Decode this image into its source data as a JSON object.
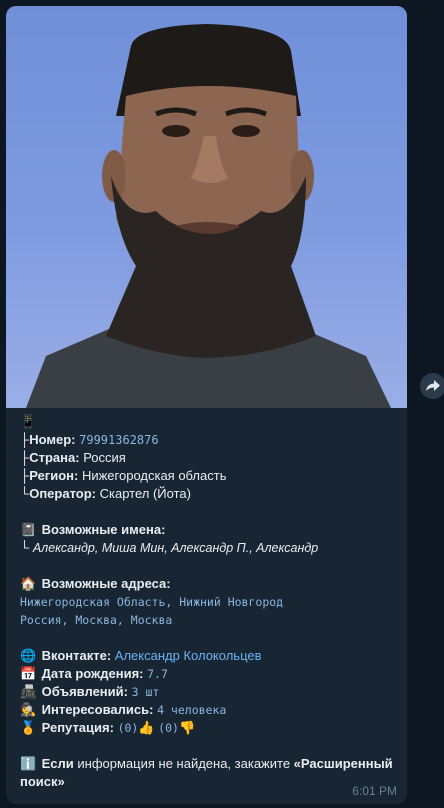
{
  "message": {
    "phone_emoji": "📱",
    "number_label": "Номер:",
    "number_value": "79991362876",
    "country_label": "Страна:",
    "country_value": "Россия",
    "region_label": "Регион:",
    "region_value": "Нижегородская область",
    "operator_label": "Оператор:",
    "operator_value": "Скартел (Йота)",
    "names_emoji": "📓",
    "names_label": "Возможные имена:",
    "names_value": "Александр, Миша Мин, Александр П., Александр",
    "addr_emoji": "🏠",
    "addr_label": "Возможные адреса:",
    "addr_line1": "Нижегородская Область, Нижний Новгород",
    "addr_line2": "Россия, Москва, Москва",
    "vk_emoji": "🌐",
    "vk_label": "Вконтакте:",
    "vk_value": "Александр Колокольцев",
    "dob_emoji": "📅",
    "dob_label": "Дата рождения:",
    "dob_value": "7.7",
    "ads_emoji": "📠",
    "ads_label": "Объявлений:",
    "ads_value": "3 шт",
    "interest_emoji": "🕵",
    "interest_label": "Интересовались:",
    "interest_value": "4 человека",
    "rep_emoji": "🏅",
    "rep_label": "Репутация:",
    "rep_up_count": "(0)",
    "rep_up_emoji": "👍",
    "rep_down_count": "(0)",
    "rep_down_emoji": "👎",
    "info_emoji": "ℹ️",
    "info_bold1": "Если",
    "info_text": " информация не найдена, закажите ",
    "info_bold2": "«Расширенный поиск»",
    "time": "6:01 PM"
  },
  "forward_icon": "share-arrow-icon"
}
